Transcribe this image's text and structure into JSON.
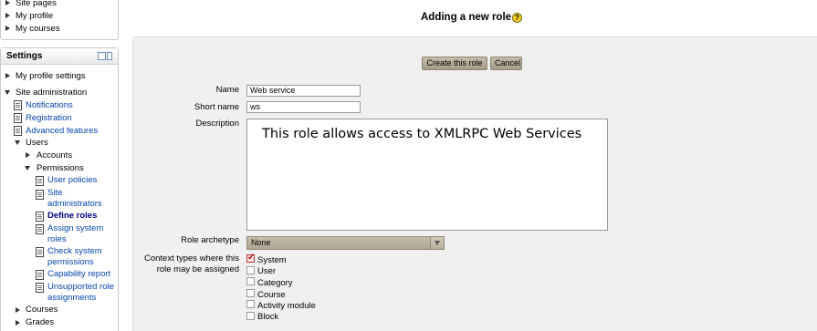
{
  "nav_block": {
    "items": [
      {
        "label": "Site pages"
      },
      {
        "label": "My profile"
      },
      {
        "label": "My courses"
      }
    ]
  },
  "settings": {
    "title": "Settings",
    "my_profile_settings": "My profile settings",
    "site_administration": "Site administration",
    "notifications": "Notifications",
    "registration": "Registration",
    "advanced_features": "Advanced features",
    "users": "Users",
    "accounts": "Accounts",
    "permissions": "Permissions",
    "user_policies": "User policies",
    "site_administrators_1": "Site",
    "site_administrators_2": "administrators",
    "define_roles": "Define roles",
    "assign_system_roles_1": "Assign system",
    "assign_system_roles_2": "roles",
    "check_system_permissions_1": "Check system",
    "check_system_permissions_2": "permissions",
    "capability_report": "Capability report",
    "unsupported_role_assignments_1": "Unsupported role",
    "unsupported_role_assignments_2": "assignments",
    "courses": "Courses",
    "grades": "Grades"
  },
  "page": {
    "title": "Adding a new role",
    "help_icon_glyph": "?"
  },
  "form": {
    "create_button": "Create this role",
    "cancel_button": "Cancel",
    "name_label": "Name",
    "name_value": "Web service",
    "shortname_label": "Short name",
    "shortname_value": "ws",
    "description_label": "Description",
    "description_value": "This role allows access to XMLRPC Web Services",
    "archetype_label": "Role archetype",
    "archetype_value": "None",
    "context_label_1": "Context types where this",
    "context_label_2": "role may be assigned",
    "contexts": [
      {
        "label": "System",
        "checked": true
      },
      {
        "label": "User",
        "checked": false
      },
      {
        "label": "Category",
        "checked": false
      },
      {
        "label": "Course",
        "checked": false
      },
      {
        "label": "Activity module",
        "checked": false
      },
      {
        "label": "Block",
        "checked": false
      }
    ]
  },
  "colors": {
    "link": "#0645ad",
    "panel_bg": "#f0f0f0",
    "button_bg": "#b5ac98",
    "checked": "#c00000"
  }
}
